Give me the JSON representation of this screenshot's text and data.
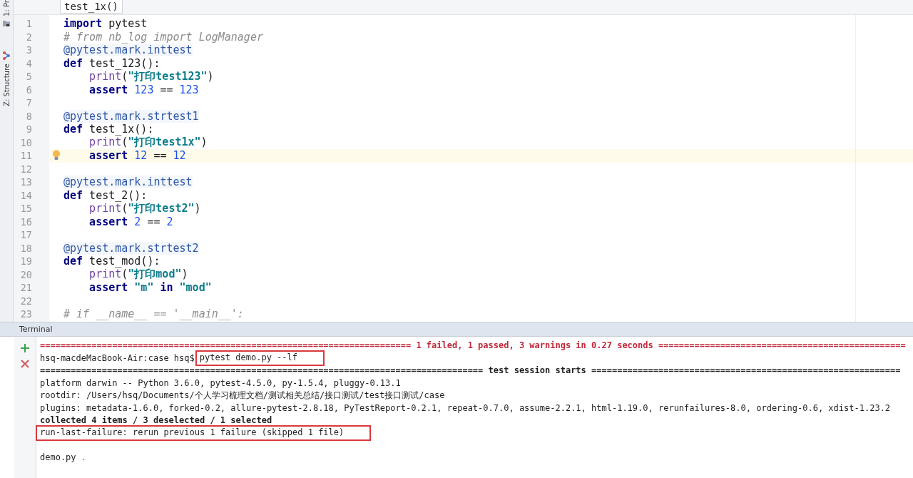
{
  "tool_strip": [
    {
      "label": "1: Pr"
    },
    {
      "label": "Z: Structure"
    }
  ],
  "breadcrumb": "test_1x()",
  "code_lines": [
    {
      "number": "1",
      "current": false,
      "tokens": [
        {
          "text": "import",
          "kind": "keyword"
        },
        {
          "text": " pytest",
          "kind": "plain"
        }
      ]
    },
    {
      "number": "2",
      "current": false,
      "tokens": [
        {
          "text": "# from nb_log import LogManager",
          "kind": "comment"
        }
      ]
    },
    {
      "number": "3",
      "current": false,
      "tokens": [
        {
          "text": "@pytest.mark.inttest",
          "kind": "decorator"
        }
      ]
    },
    {
      "number": "4",
      "current": false,
      "tokens": [
        {
          "text": "def",
          "kind": "keyword"
        },
        {
          "text": " test_123():",
          "kind": "plain"
        }
      ]
    },
    {
      "number": "5",
      "current": false,
      "tokens": [
        {
          "text": "    print",
          "kind": "builtin"
        },
        {
          "text": "(",
          "kind": "plain"
        },
        {
          "text": "\"打印test123\"",
          "kind": "string"
        },
        {
          "text": ")",
          "kind": "plain"
        }
      ]
    },
    {
      "number": "6",
      "current": false,
      "tokens": [
        {
          "text": "    assert ",
          "kind": "keyword"
        },
        {
          "text": "123",
          "kind": "number"
        },
        {
          "text": " == ",
          "kind": "plain"
        },
        {
          "text": "123",
          "kind": "number"
        }
      ]
    },
    {
      "number": "7",
      "current": false
    },
    {
      "number": "8",
      "current": false,
      "tokens": [
        {
          "text": "@pytest.mark.strtest1",
          "kind": "decorator"
        }
      ]
    },
    {
      "number": "9",
      "current": false,
      "tokens": [
        {
          "text": "def",
          "kind": "keyword"
        },
        {
          "text": " test_1x():",
          "kind": "plain"
        }
      ]
    },
    {
      "number": "10",
      "current": false,
      "tokens": [
        {
          "text": "    print",
          "kind": "builtin"
        },
        {
          "text": "(",
          "kind": "plain"
        },
        {
          "text": "\"打印test1x\"",
          "kind": "string"
        },
        {
          "text": ")",
          "kind": "plain"
        }
      ]
    },
    {
      "number": "11",
      "current": true,
      "tokens": [
        {
          "text": "    assert ",
          "kind": "keyword"
        },
        {
          "text": "12",
          "kind": "number"
        },
        {
          "text": " == ",
          "kind": "plain"
        },
        {
          "text": "12",
          "kind": "number"
        }
      ]
    },
    {
      "number": "12",
      "current": false
    },
    {
      "number": "13",
      "current": false,
      "tokens": [
        {
          "text": "@pytest.mark.inttest",
          "kind": "decorator"
        }
      ]
    },
    {
      "number": "14",
      "current": false,
      "tokens": [
        {
          "text": "def",
          "kind": "keyword"
        },
        {
          "text": " test_2():",
          "kind": "plain"
        }
      ]
    },
    {
      "number": "15",
      "current": false,
      "tokens": [
        {
          "text": "    print",
          "kind": "builtin"
        },
        {
          "text": "(",
          "kind": "plain"
        },
        {
          "text": "\"打印test2\"",
          "kind": "string"
        },
        {
          "text": ")",
          "kind": "plain"
        }
      ]
    },
    {
      "number": "16",
      "current": false,
      "tokens": [
        {
          "text": "    assert ",
          "kind": "keyword"
        },
        {
          "text": "2",
          "kind": "number"
        },
        {
          "text": " == ",
          "kind": "plain"
        },
        {
          "text": "2",
          "kind": "number"
        }
      ]
    },
    {
      "number": "17",
      "current": false
    },
    {
      "number": "18",
      "current": false,
      "tokens": [
        {
          "text": "@pytest.mark.strtest2",
          "kind": "decorator"
        }
      ]
    },
    {
      "number": "19",
      "current": false,
      "tokens": [
        {
          "text": "def",
          "kind": "keyword"
        },
        {
          "text": " test_mod():",
          "kind": "plain"
        }
      ]
    },
    {
      "number": "20",
      "current": false,
      "tokens": [
        {
          "text": "    print",
          "kind": "builtin"
        },
        {
          "text": "(",
          "kind": "plain"
        },
        {
          "text": "\"打印mod\"",
          "kind": "string"
        },
        {
          "text": ")",
          "kind": "plain"
        }
      ]
    },
    {
      "number": "21",
      "current": false,
      "tokens": [
        {
          "text": "    assert ",
          "kind": "keyword"
        },
        {
          "text": "\"m\" ",
          "kind": "string"
        },
        {
          "text": "in ",
          "kind": "keyword"
        },
        {
          "text": "\"mod\"",
          "kind": "string"
        }
      ]
    },
    {
      "number": "22",
      "current": false
    },
    {
      "number": "23",
      "current": false,
      "tokens": [
        {
          "text": "# if __name__ == '__main__':",
          "kind": "comment"
        }
      ]
    }
  ],
  "terminal": {
    "title": "Terminal",
    "lines": [
      {
        "segments": [
          {
            "text": "======================================================================== 1 failed, 1 passed, 3 warnings in 0.27 seconds ================================================",
            "kind": "failure",
            "boxed": false
          }
        ]
      },
      {
        "segments": [
          {
            "text": "hsq-macdeMacBook-Air:case hsq$",
            "kind": "plain",
            "boxed": false
          },
          {
            "text": "pytest demo.py --lf",
            "kind": "plain",
            "boxed": true
          }
        ]
      },
      {
        "segments": [
          {
            "text": "====================================================================================== test session starts ============================================================",
            "kind": "bold",
            "boxed": false
          }
        ]
      },
      {
        "segments": [
          {
            "text": "platform darwin -- Python 3.6.0, pytest-4.5.0, py-1.5.4, pluggy-0.13.1",
            "kind": "plain",
            "boxed": false
          }
        ]
      },
      {
        "segments": [
          {
            "text": "rootdir: /Users/hsq/Documents/个人学习梳理文档/测试相关总结/接口测试/test接口测试/case",
            "kind": "plain",
            "boxed": false
          }
        ]
      },
      {
        "segments": [
          {
            "text": "plugins: metadata-1.6.0, forked-0.2, allure-pytest-2.8.18, PyTestReport-0.2.1, repeat-0.7.0, assume-2.2.1, html-1.19.0, rerunfailures-8.0, ordering-0.6, xdist-1.23.2",
            "kind": "plain",
            "boxed": false
          }
        ]
      },
      {
        "segments": [
          {
            "text": "collected 4 items / 3 deselected / 1 selected",
            "kind": "bold",
            "boxed": false
          }
        ]
      },
      {
        "segments": [
          {
            "text": "run-last-failure: rerun previous 1 failure (skipped 1 file)",
            "kind": "plain",
            "boxed": true
          }
        ]
      },
      {
        "segments": [
          {
            "text": "demo.py",
            "kind": "plain",
            "boxed": false
          },
          {
            "text": ".",
            "kind": "pass",
            "boxed": false
          }
        ]
      }
    ]
  }
}
